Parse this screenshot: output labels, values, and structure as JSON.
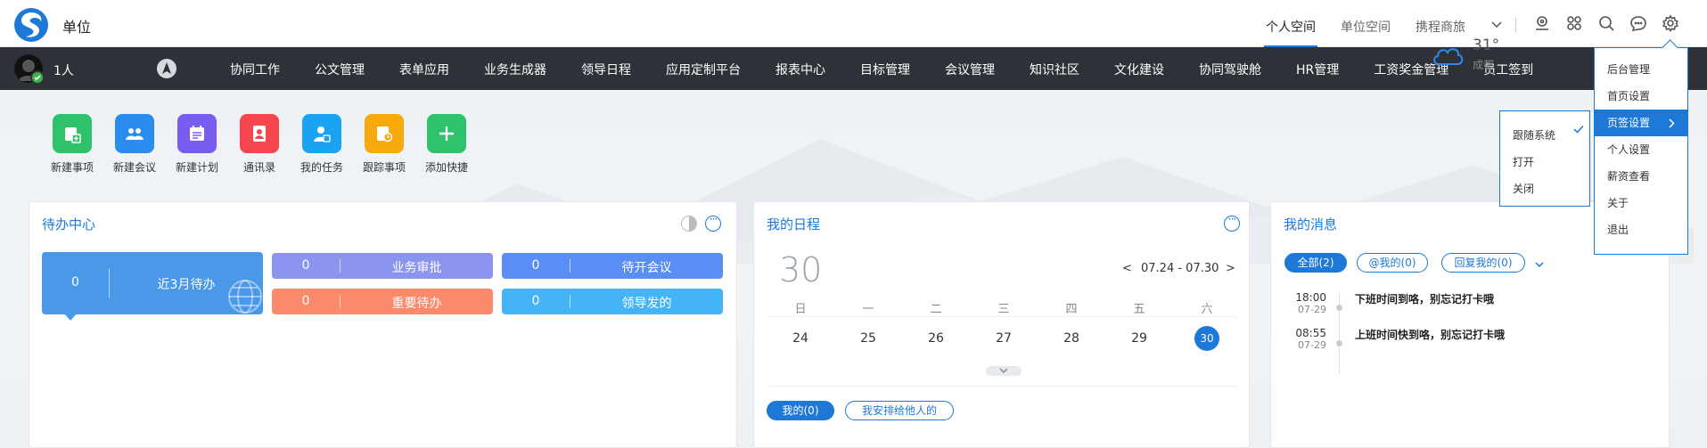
{
  "topbar": {
    "unit_title": "单位",
    "space_tabs": [
      {
        "label": "个人空间",
        "active": true
      },
      {
        "label": "单位空间",
        "active": false
      },
      {
        "label": "携程商旅",
        "active": false
      }
    ],
    "icons": [
      "location-icon",
      "apps-icon",
      "search-icon",
      "chat-icon",
      "gear-icon"
    ]
  },
  "nav": {
    "user_count": "1人",
    "items": [
      "协同工作",
      "公文管理",
      "表单应用",
      "业务生成器",
      "领导日程",
      "应用定制平台",
      "报表中心",
      "目标管理",
      "会议管理",
      "知识社区",
      "文化建设",
      "协同驾驶舱",
      "HR管理",
      "工资奖金管理",
      "员工签到"
    ]
  },
  "quick_actions": [
    {
      "label": "新建事项",
      "color": "#2ec26a",
      "icon": "new-item-icon"
    },
    {
      "label": "新建会议",
      "color": "#2b8cef",
      "icon": "new-meeting-icon"
    },
    {
      "label": "新建计划",
      "color": "#7b5cf0",
      "icon": "new-plan-icon"
    },
    {
      "label": "通讯录",
      "color": "#f5454f",
      "icon": "contacts-icon"
    },
    {
      "label": "我的任务",
      "color": "#1aa3f0",
      "icon": "my-task-icon"
    },
    {
      "label": "跟踪事项",
      "color": "#f8a90c",
      "icon": "track-item-icon"
    },
    {
      "label": "添加快捷",
      "color": "#2ec26a",
      "icon": "add-shortcut-icon"
    }
  ],
  "weather": {
    "temp": "31°",
    "city": "成都"
  },
  "todo": {
    "title": "待办中心",
    "main": {
      "count": "0",
      "label": "近3月待办",
      "color": "#4a98e8"
    },
    "cards": [
      {
        "count": "0",
        "label": "业务审批",
        "color": "#8b94ef"
      },
      {
        "count": "0",
        "label": "待开会议",
        "color": "#5b8ef5"
      },
      {
        "count": "0",
        "label": "重要待办",
        "color": "#fb8a6c"
      },
      {
        "count": "0",
        "label": "领导发的",
        "color": "#45b4f7"
      }
    ]
  },
  "schedule": {
    "title": "我的日程",
    "day": "30",
    "range": "07.24 - 07.30",
    "prev": "<",
    "next": ">",
    "weekdays": [
      "日",
      "一",
      "二",
      "三",
      "四",
      "五",
      "六"
    ],
    "dates": [
      "24",
      "25",
      "26",
      "27",
      "28",
      "29",
      "30"
    ],
    "today": "30",
    "filters": [
      {
        "label": "我的(0)",
        "active": true
      },
      {
        "label": "我安排给他人的",
        "active": false
      }
    ]
  },
  "messages": {
    "title": "我的消息",
    "filters": [
      {
        "label": "全部(2)",
        "active": true
      },
      {
        "label": "@我的(0)",
        "active": false
      },
      {
        "label": "回复我的(0)",
        "active": false
      }
    ],
    "items": [
      {
        "time": "18:00",
        "date": "07-29",
        "text": "下班时间到咯，别忘记打卡哦"
      },
      {
        "time": "08:55",
        "date": "07-29",
        "text": "上班时间快到咯，别忘记打卡哦"
      }
    ]
  },
  "settings_menu": {
    "items": [
      "后台管理",
      "首页设置",
      "页签设置",
      "个人设置",
      "薪资查看",
      "关于",
      "退出"
    ],
    "active_index": 2
  },
  "tab_submenu": {
    "items": [
      "跟随系统",
      "打开",
      "关闭"
    ],
    "checked_index": 0
  },
  "colors": {
    "accent": "#1e78d8",
    "navbar": "#2e3238"
  }
}
